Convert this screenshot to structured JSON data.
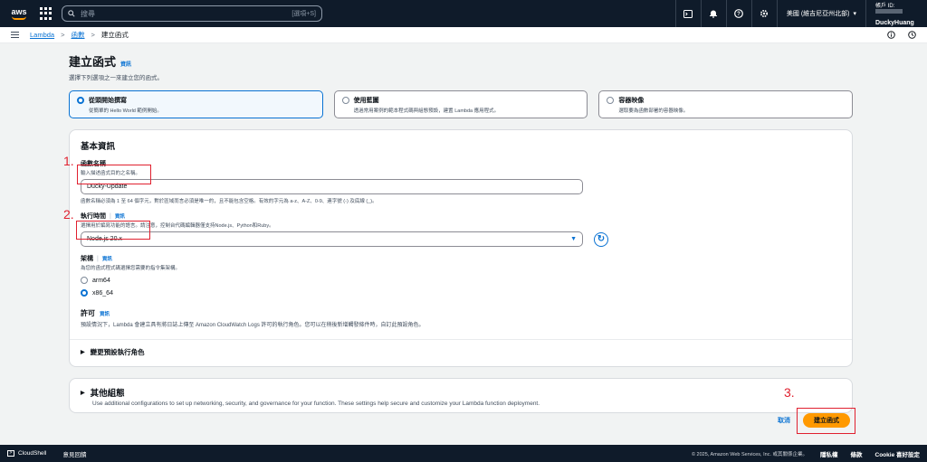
{
  "topnav": {
    "logo_text": "aws",
    "search_placeholder": "搜尋",
    "search_shortcut": "[選項+S]",
    "region": "美國 (維吉尼亞州北部)",
    "account_id_label": "帳戶 ID:",
    "username": "DuckyHuang"
  },
  "breadcrumb": {
    "items": [
      "Lambda",
      "函數",
      "建立函式"
    ]
  },
  "page": {
    "title": "建立函式",
    "info": "資訊",
    "subtitle": "選擇下列選項之一來建立您的函式。"
  },
  "tiles": [
    {
      "title": "從頭開始撰寫",
      "desc": "從簡單的 Hello World 範例開始。",
      "selected": true
    },
    {
      "title": "使用藍圖",
      "desc": "透過常用案例的範本程式碼與組態預設，建置 Lambda 應用程式。",
      "selected": false
    },
    {
      "title": "容器映像",
      "desc": "選取要為函數部署的容器映像。",
      "selected": false
    }
  ],
  "basic": {
    "heading": "基本資訊",
    "name_label": "函數名稱",
    "name_desc": "輸入描述函式目的之名稱。",
    "name_value": "Ducky-Update",
    "name_constraint": "函數名稱必須為 1 至 64 個字元，對於區域而言必須是唯一的，且不能包含空格。有效的字元為 a-z、A-Z、0-9、連字號 (-) 及底線 (_)。",
    "runtime_label": "執行時間",
    "runtime_info": "資訊",
    "runtime_desc": "選擇用於編寫功能的語言。請注意，控制台代碼編輯器僅支持Node.js、Python和Ruby。",
    "runtime_value": "Node.js 20.x",
    "arch_label": "架構",
    "arch_info": "資訊",
    "arch_desc": "為您的函式程式碼選擇您需要的指令集架構。",
    "arch_options": [
      "arm64",
      "x86_64"
    ],
    "arch_selected": "x86_64",
    "perm_label": "許可",
    "perm_info": "資訊",
    "perm_desc": "預設情況下，Lambda 會建立具有將日誌上傳至 Amazon CloudWatch Logs 許可的執行角色。您可以在稍後新增觸發條件時，自訂此預設角色。",
    "role_expander": "變更預設執行角色"
  },
  "other": {
    "heading": "其他組態",
    "desc": "Use additional configurations to set up networking, security, and governance for your function. These settings help secure and customize your Lambda function deployment."
  },
  "actions": {
    "cancel": "取消",
    "create": "建立函式"
  },
  "annotations": [
    "1.",
    "2.",
    "3."
  ],
  "footer": {
    "cloudshell": "CloudShell",
    "feedback": "意見回饋",
    "copyright": "© 2025, Amazon Web Services, Inc. 或其關係企業。",
    "privacy": "隱私權",
    "terms": "條款",
    "cookie": "Cookie 喜好設定"
  },
  "colors": {
    "accent": "#0972d3",
    "primary_button": "#ff9900",
    "annotation": "#e0202f",
    "nav_bg": "#0f1b2a"
  }
}
